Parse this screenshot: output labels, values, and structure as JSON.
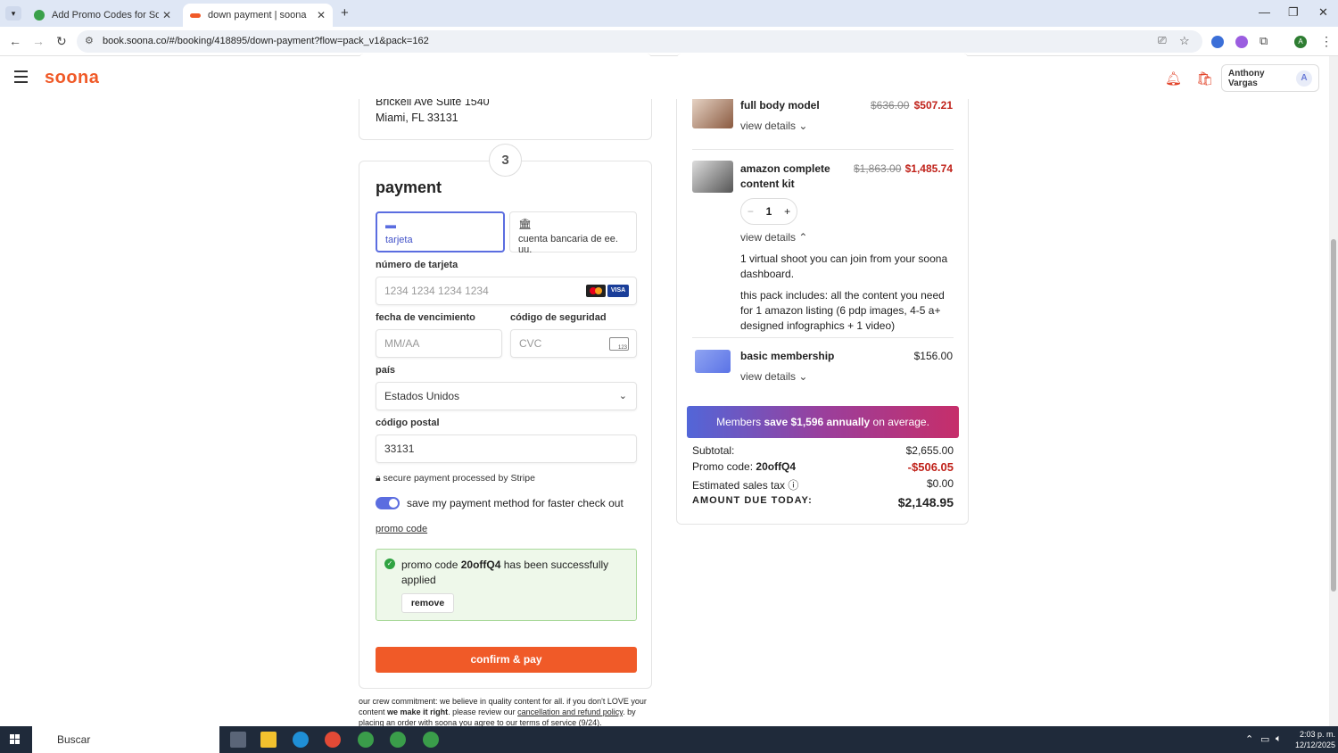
{
  "browser": {
    "tabs": [
      {
        "title": "Add Promo Codes for Soona –",
        "active": false
      },
      {
        "title": "down payment | soona",
        "active": true
      }
    ],
    "url": "book.soona.co/#/booking/418895/down-payment?flow=pack_v1&pack=162"
  },
  "header": {
    "logo": "soona",
    "user_name": "Anthony Vargas",
    "avatar_initial": "A"
  },
  "address": {
    "line1": "Brickell Ave Suite 1540",
    "line2": "Miami, FL 33131"
  },
  "payment": {
    "step_number": "3",
    "title": "payment",
    "methods": [
      {
        "label": "tarjeta",
        "icon": "card-icon",
        "selected": true
      },
      {
        "label": "cuenta bancaria de ee. uu.",
        "icon": "bank-icon",
        "selected": false
      }
    ],
    "card_number_label": "número de tarjeta",
    "card_number_placeholder": "1234 1234 1234 1234",
    "expiry_label": "fecha de vencimiento",
    "expiry_placeholder": "MM/AA",
    "cvc_label": "código de seguridad",
    "cvc_placeholder": "CVC",
    "cvc_icon_text": "123",
    "visa_text": "VISA",
    "country_label": "país",
    "country_value": "Estados Unidos",
    "postal_label": "código postal",
    "postal_value": "33131",
    "secure_text": "secure payment processed by Stripe",
    "save_method_text": "save my payment method for faster check out",
    "save_method_on": true,
    "promo_link": "promo code",
    "promo_msg_prefix": "promo code",
    "promo_code": "20offQ4",
    "promo_msg_suffix": "has been successfully applied",
    "remove_label": "remove",
    "confirm_label": "confirm & pay"
  },
  "crew": {
    "text1": "our crew commitment: we believe in quality content for all. if you don't LOVE your content",
    "bold": "we make it right",
    "text2": ". please review our",
    "link1": "cancellation and refund policy",
    "text3": ". by placing an order with soona you agree to our",
    "link2": "terms of service",
    "text4": "(9/24)."
  },
  "summary": {
    "items": [
      {
        "name": "full body model",
        "original": "$636.00",
        "price": "$507.21",
        "view": "view details"
      },
      {
        "name": "amazon complete content kit",
        "original": "$1,863.00",
        "price": "$1,485.74",
        "quantity": "1",
        "view": "view details",
        "desc1": "1 virtual shoot you can join from your soona dashboard.",
        "desc2": "this pack includes: all the content you need for 1 amazon listing (6 pdp images, 4-5 a+ designed infographics + 1 video)"
      },
      {
        "name": "basic membership",
        "price": "$156.00",
        "view": "view details"
      }
    ],
    "banner_pre": "Members",
    "banner_bold": "save $1,596 annually",
    "banner_post": "on average.",
    "subtotal_label": "Subtotal:",
    "subtotal": "$2,655.00",
    "promo_label": "Promo code:",
    "promo_code": "20offQ4",
    "promo_amount": "-$506.05",
    "tax_label": "Estimated sales tax",
    "tax": "$0.00",
    "due_label": "AMOUNT DUE TODAY:",
    "due": "$2,148.95"
  },
  "taskbar": {
    "search_placeholder": "Buscar",
    "time": "2:03 p. m.",
    "date": "12/12/2025"
  },
  "colors": {
    "brand": "#f05a28",
    "accent": "#5b6de0",
    "discount": "#c0221a",
    "success": "#2fa341"
  }
}
